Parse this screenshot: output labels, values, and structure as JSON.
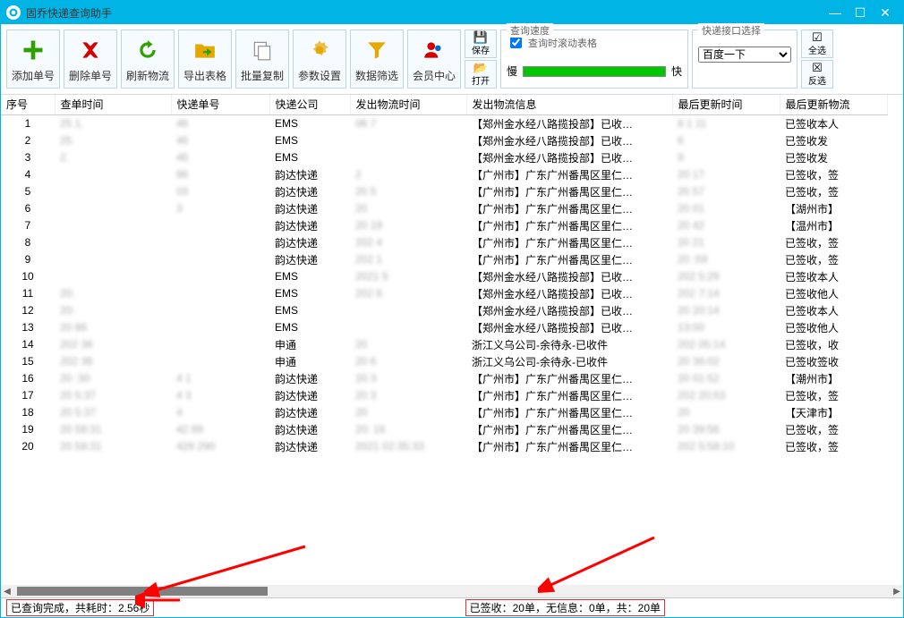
{
  "window": {
    "title": "固乔快递查询助手"
  },
  "toolbar": {
    "add": "添加单号",
    "del": "删除单号",
    "refresh": "刷新物流",
    "export": "导出表格",
    "copy": "批量复制",
    "settings": "参数设置",
    "filter": "数据筛选",
    "vip": "会员中心",
    "save": "保存",
    "open": "打开",
    "select_all": "全选",
    "invert": "反选"
  },
  "speed": {
    "legend": "查询速度",
    "scroll_checkbox": "查询时滚动表格",
    "slow": "慢",
    "fast": "快"
  },
  "iface": {
    "legend": "快递接口选择",
    "selected": "百度一下",
    "options": [
      "百度一下"
    ]
  },
  "columns": {
    "serial": "序号",
    "query_time": "查单时间",
    "tracking_no": "快递单号",
    "company": "快递公司",
    "send_time": "发出物流时间",
    "send_info": "发出物流信息",
    "last_time": "最后更新时间",
    "last_info": "最后更新物流"
  },
  "rows": [
    {
      "n": "1",
      "qt": "25 1.",
      "tn": "46",
      "co": "EMS",
      "st": "06  7",
      "si": "【郑州金水经八路揽投部】已收…",
      "lt": "8 1 11",
      "li": "已签收本人"
    },
    {
      "n": "2",
      "qt": "25",
      "tn": "46",
      "co": "EMS",
      "st": "",
      "si": "【郑州金水经八路揽投部】已收…",
      "lt": "  6",
      "li": "已签收发"
    },
    {
      "n": "3",
      "qt": "2.",
      "tn": "46",
      "co": "EMS",
      "st": "",
      "si": "【郑州金水经八路揽投部】已收…",
      "lt": " 9",
      "li": "已签收发"
    },
    {
      "n": "4",
      "qt": "",
      "tn": "86",
      "co": "韵达快递",
      "st": "2",
      "si": "【广州市】广东广州番禺区里仁…",
      "lt": "20 17",
      "li": "已签收，签"
    },
    {
      "n": "5",
      "qt": "",
      "tn": "03",
      "co": "韵达快递",
      "st": "20 5",
      "si": "【广州市】广东广州番禺区里仁…",
      "lt": "20 57",
      "li": "已签收，签"
    },
    {
      "n": "6",
      "qt": "",
      "tn": "3",
      "co": "韵达快递",
      "st": "20",
      "si": "【广州市】广东广州番禺区里仁…",
      "lt": "20 01",
      "li": "【湖州市】"
    },
    {
      "n": "7",
      "qt": "",
      "tn": "",
      "co": "韵达快递",
      "st": "20 19",
      "si": "【广州市】广东广州番禺区里仁…",
      "lt": "20 42",
      "li": "【温州市】"
    },
    {
      "n": "8",
      "qt": "",
      "tn": "",
      "co": "韵达快递",
      "st": "202 4",
      "si": "【广州市】广东广州番禺区里仁…",
      "lt": "20 21",
      "li": "已签收，签"
    },
    {
      "n": "9",
      "qt": "",
      "tn": "",
      "co": "韵达快递",
      "st": "202 1",
      "si": "【广州市】广东广州番禺区里仁…",
      "lt": "20 :59",
      "li": "已签收，签"
    },
    {
      "n": "10",
      "qt": "",
      "tn": "",
      "co": "EMS",
      "st": "2021 5",
      "si": "【郑州金水经八路揽投部】已收…",
      "lt": "202 5:29",
      "li": "已签收本人"
    },
    {
      "n": "11",
      "qt": "20:",
      "tn": "",
      "co": "EMS",
      "st": "202 6",
      "si": "【郑州金水经八路揽投部】已收…",
      "lt": "202 7:14",
      "li": "已签收他人"
    },
    {
      "n": "12",
      "qt": "20:",
      "tn": "",
      "co": "EMS",
      "st": "",
      "si": "【郑州金水经八路揽投部】已收…",
      "lt": "20 20:14",
      "li": "已签收本人"
    },
    {
      "n": "13",
      "qt": "20 86",
      "tn": "",
      "co": "EMS",
      "st": "",
      "si": "【郑州金水经八路揽投部】已收…",
      "lt": "13:00",
      "li": "已签收他人"
    },
    {
      "n": "14",
      "qt": "202 36",
      "tn": "",
      "co": "申通",
      "st": "20",
      "si": "浙江义乌公司-余待永-已收件",
      "lt": "202 05:14",
      "li": "已签收，收"
    },
    {
      "n": "15",
      "qt": "202 36",
      "tn": "",
      "co": "申通",
      "st": "20 6",
      "si": "浙江义乌公司-余待永-已收件",
      "lt": "20 36:02",
      "li": "已签收签收"
    },
    {
      "n": "16",
      "qt": "20 :30",
      "tn": "4 1",
      "co": "韵达快递",
      "st": "20 3",
      "si": "【广州市】广东广州番禺区里仁…",
      "lt": "20 01:52",
      "li": "【潮州市】"
    },
    {
      "n": "17",
      "qt": "20 5:37",
      "tn": "4 3",
      "co": "韵达快递",
      "st": "20 3",
      "si": "【广州市】广东广州番禺区里仁…",
      "lt": "202 20:53",
      "li": "已签收，签"
    },
    {
      "n": "18",
      "qt": "20 5:37",
      "tn": "4 ",
      "co": "韵达快递",
      "st": "20",
      "si": "【广州市】广东广州番禺区里仁…",
      "lt": "20",
      "li": "【天津市】"
    },
    {
      "n": "19",
      "qt": "20 58:31",
      "tn": "42 89",
      "co": "韵达快递",
      "st": "20: 16",
      "si": "【广州市】广东广州番禺区里仁…",
      "lt": "20 39:56",
      "li": "已签收，签"
    },
    {
      "n": "20",
      "qt": "20 58:31",
      "tn": "428 290",
      "co": "韵达快递",
      "st": "2021 02:35:33",
      "si": "【广州市】广东广州番禺区里仁…",
      "lt": "202 5:58:10",
      "li": "已签收，签"
    }
  ],
  "status": {
    "left": "已查询完成，共耗时：2.56秒",
    "right": "已签收：20单，无信息：0单，共：20单"
  },
  "colors": {
    "title_bg": "#00b4e6",
    "border": "#bcd6e6"
  }
}
